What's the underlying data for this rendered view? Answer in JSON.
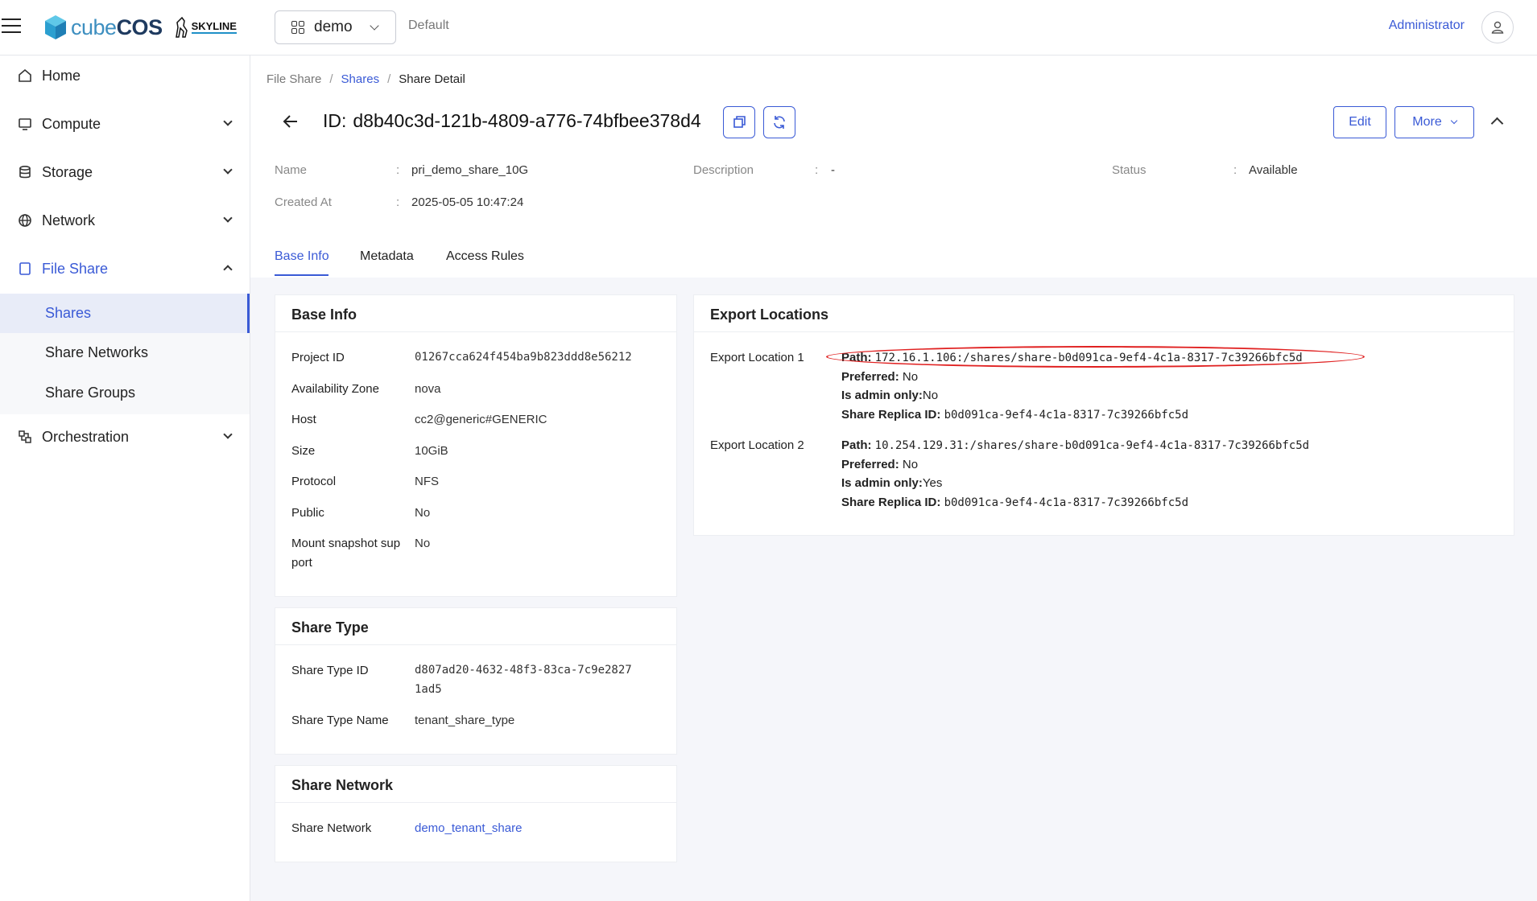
{
  "header": {
    "logo_cube": "cube",
    "logo_cos": "COS",
    "skyline": "SKYLINE",
    "project": "demo",
    "domain": "Default",
    "user": "Administrator"
  },
  "sidebar": {
    "items": [
      {
        "label": "Home",
        "icon": "home-icon"
      },
      {
        "label": "Compute",
        "icon": "monitor-icon"
      },
      {
        "label": "Storage",
        "icon": "database-icon"
      },
      {
        "label": "Network",
        "icon": "globe-icon"
      },
      {
        "label": "File Share",
        "icon": "file-icon"
      },
      {
        "label": "Orchestration",
        "icon": "orchestration-icon"
      }
    ],
    "sub_items": [
      "Shares",
      "Share Networks",
      "Share Groups"
    ]
  },
  "breadcrumb": {
    "root": "File Share",
    "parent": "Shares",
    "current": "Share Detail"
  },
  "detail": {
    "id_label": "ID:",
    "id_value": "d8b40c3d-121b-4809-a776-74bfbee378d4",
    "edit_label": "Edit",
    "more_label": "More"
  },
  "meta": {
    "name_label": "Name",
    "name_value": "pri_demo_share_10G",
    "created_label": "Created At",
    "created_value": "2025-05-05 10:47:24",
    "description_label": "Description",
    "description_value": "-",
    "status_label": "Status",
    "status_value": "Available",
    "colon": ":"
  },
  "tabs": [
    "Base Info",
    "Metadata",
    "Access Rules"
  ],
  "base_info": {
    "title": "Base Info",
    "rows": [
      {
        "label": "Project ID",
        "value": "01267cca624f454ba9b823ddd8e56212"
      },
      {
        "label": "Availability Zone",
        "value": "nova"
      },
      {
        "label": "Host",
        "value": "cc2@generic#GENERIC"
      },
      {
        "label": "Size",
        "value": "10GiB"
      },
      {
        "label": "Protocol",
        "value": "NFS"
      },
      {
        "label": "Public",
        "value": "No"
      },
      {
        "label": "Mount snapshot sup",
        "label2": "port",
        "value": "No"
      }
    ]
  },
  "share_type": {
    "title": "Share Type",
    "id_label": "Share Type ID",
    "id_value_1": "d807ad20-4632-48f3-83ca-7c9e2827",
    "id_value_2": "1ad5",
    "name_label": "Share Type Name",
    "name_value": "tenant_share_type"
  },
  "share_network": {
    "title": "Share Network",
    "label": "Share Network",
    "value": "demo_tenant_share"
  },
  "export_locations": {
    "title": "Export Locations",
    "items": [
      {
        "label": "Export Location 1",
        "path": "172.16.1.106:/shares/share-b0d091ca-9ef4-4c1a-8317-7c39266bfc5d",
        "preferred": "No",
        "admin_only": "No",
        "replica_id": "b0d091ca-9ef4-4c1a-8317-7c39266bfc5d"
      },
      {
        "label": "Export Location 2",
        "path": "10.254.129.31:/shares/share-b0d091ca-9ef4-4c1a-8317-7c39266bfc5d",
        "preferred": "No",
        "admin_only": "Yes",
        "replica_id": "b0d091ca-9ef4-4c1a-8317-7c39266bfc5d"
      }
    ],
    "path_key": "Path:",
    "preferred_key": "Preferred:",
    "admin_key": "Is admin only:",
    "replica_key": "Share Replica ID:"
  }
}
